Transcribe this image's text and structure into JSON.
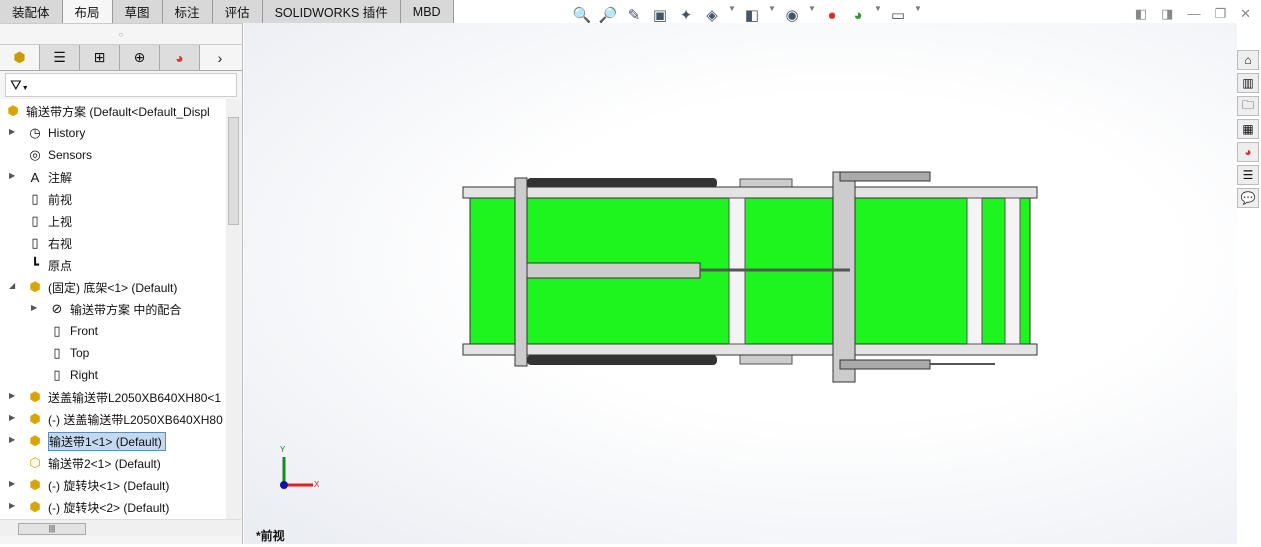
{
  "tabs": [
    "装配体",
    "布局",
    "草图",
    "标注",
    "评估",
    "SOLIDWORKS 插件",
    "MBD"
  ],
  "active_tab": 1,
  "tree": {
    "root": "输送带方案  (Default<Default_Displ",
    "items": [
      {
        "label": "History",
        "level": 1,
        "expand": true,
        "icon": "history-icon"
      },
      {
        "label": "Sensors",
        "level": 1,
        "expand": false,
        "icon": "sensors-icon"
      },
      {
        "label": "注解",
        "level": 1,
        "expand": true,
        "icon": "annotation-icon"
      },
      {
        "label": "前视",
        "level": 1,
        "expand": false,
        "icon": "plane-icon"
      },
      {
        "label": "上视",
        "level": 1,
        "expand": false,
        "icon": "plane-icon"
      },
      {
        "label": "右视",
        "level": 1,
        "expand": false,
        "icon": "plane-icon"
      },
      {
        "label": "原点",
        "level": 1,
        "expand": false,
        "icon": "origin-icon"
      },
      {
        "label": "(固定) 底架<1> (Default)",
        "level": 1,
        "expand": "open",
        "icon": "part-icon"
      },
      {
        "label": "输送带方案 中的配合",
        "level": 2,
        "expand": true,
        "icon": "mates-icon"
      },
      {
        "label": "Front",
        "level": 2,
        "expand": false,
        "icon": "plane-icon"
      },
      {
        "label": "Top",
        "level": 2,
        "expand": false,
        "icon": "plane-icon"
      },
      {
        "label": "Right",
        "level": 2,
        "expand": false,
        "icon": "plane-icon"
      },
      {
        "label": "送盖输送带L2050XB640XH80<1",
        "level": 1,
        "expand": true,
        "icon": "part-icon"
      },
      {
        "label": "(-) 送盖输送带L2050XB640XH80",
        "level": 1,
        "expand": true,
        "icon": "part-icon"
      },
      {
        "label": "输送带1<1> (Default)",
        "level": 1,
        "expand": true,
        "icon": "part-icon",
        "selected": true
      },
      {
        "label": "输送带2<1> (Default)",
        "level": 1,
        "expand": false,
        "icon": "part-outline-icon"
      },
      {
        "label": "(-) 旋转块<1> (Default)",
        "level": 1,
        "expand": true,
        "icon": "part-icon"
      },
      {
        "label": "(-) 旋转块<2> (Default)",
        "level": 1,
        "expand": true,
        "icon": "part-icon"
      }
    ]
  },
  "view_label": "*前视",
  "triad": {
    "x": "X",
    "y": "Y"
  },
  "colors": {
    "belt": "#1ef51e",
    "frame": "#c8c8c8"
  }
}
